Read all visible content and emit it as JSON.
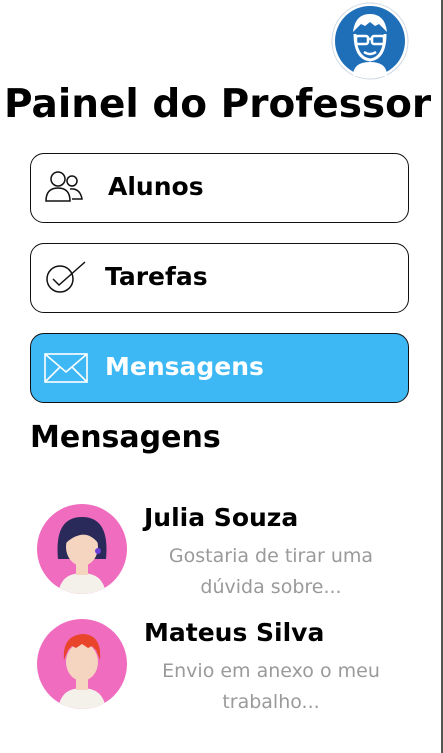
{
  "header": {
    "title": "Painel do Professor",
    "avatar_icon": "teacher-avatar-icon"
  },
  "nav": {
    "items": [
      {
        "label": "Alunos",
        "icon": "users-icon",
        "active": false
      },
      {
        "label": "Tarefas",
        "icon": "check-circle-icon",
        "active": false
      },
      {
        "label": "Mensagens",
        "icon": "envelope-icon",
        "active": true
      }
    ]
  },
  "messages": {
    "title": "Mensagens",
    "items": [
      {
        "name": "Julia Souza",
        "preview": "Gostaria de tirar uma dúvida sobre..."
      },
      {
        "name": "Mateus Silva",
        "preview": "Envio em anexo o meu trabalho..."
      }
    ]
  },
  "colors": {
    "accent": "#3db8f5",
    "avatar_bg": "#f06cbf",
    "teacher_badge": "#1f6fb8"
  }
}
